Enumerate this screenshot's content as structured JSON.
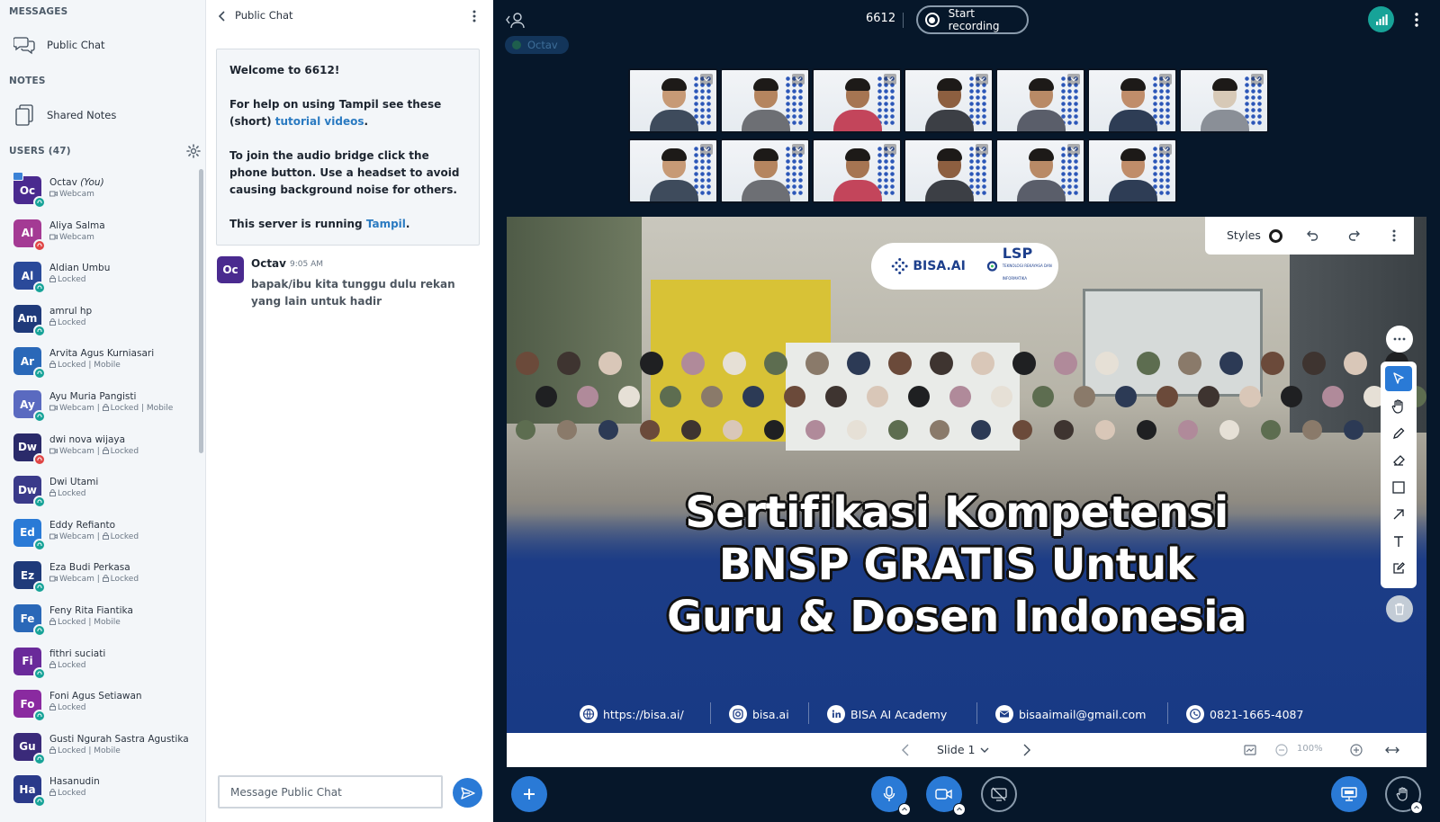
{
  "sidebar": {
    "messages_title": "MESSAGES",
    "public_chat_label": "Public Chat",
    "notes_title": "NOTES",
    "shared_notes_label": "Shared Notes",
    "users_title": "USERS (47)",
    "users": [
      {
        "initials": "Oc",
        "name": "Octav",
        "you": "(You)",
        "status": "Webcam",
        "color": "#4a2a8f",
        "badge": "#17a398",
        "presenter": true
      },
      {
        "initials": "Al",
        "name": "Aliya Salma",
        "status": "Webcam",
        "color": "#a43a94",
        "badge": "#e04545"
      },
      {
        "initials": "Al",
        "name": "Aldian Umbu",
        "status": "Locked",
        "color": "#2a4a9a",
        "badge": "#17a398"
      },
      {
        "initials": "Am",
        "name": "amrul hp",
        "status": "Locked",
        "color": "#1f3a7a",
        "badge": "#17a398"
      },
      {
        "initials": "Ar",
        "name": "Arvita Agus Kurniasari",
        "status": "Locked | Mobile",
        "color": "#2a68b8",
        "badge": "#17a398"
      },
      {
        "initials": "Ay",
        "name": "Ayu Muria Pangisti",
        "status": "Webcam | Locked | Mobile",
        "color": "#5a6ac0",
        "badge": "#17a398"
      },
      {
        "initials": "Dw",
        "name": "dwi nova wijaya",
        "status": "Webcam | Locked",
        "color": "#2a2a6a",
        "badge": "#e04545"
      },
      {
        "initials": "Dw",
        "name": "Dwi Utami",
        "status": "Locked",
        "color": "#3a3a8a",
        "badge": "#17a398"
      },
      {
        "initials": "Ed",
        "name": "Eddy Refianto",
        "status": "Webcam | Locked",
        "color": "#2a7ad6",
        "badge": "#17a398"
      },
      {
        "initials": "Ez",
        "name": "Eza Budi Perkasa",
        "status": "Webcam | Locked",
        "color": "#1f3a7a",
        "badge": "#17a398"
      },
      {
        "initials": "Fe",
        "name": "Feny Rita Fiantika",
        "status": "Locked | Mobile",
        "color": "#2a68b8",
        "badge": "#17a398"
      },
      {
        "initials": "Fi",
        "name": "fithri suciati",
        "status": "Locked",
        "color": "#6a2a9a",
        "badge": "#17a398"
      },
      {
        "initials": "Fo",
        "name": "Foni Agus Setiawan",
        "status": "Locked",
        "color": "#8a2aa0",
        "badge": "#17a398"
      },
      {
        "initials": "Gu",
        "name": "Gusti Ngurah Sastra Agustika",
        "status": "Locked | Mobile",
        "color": "#3a2a7a",
        "badge": "#17a398"
      },
      {
        "initials": "Ha",
        "name": "Hasanudin",
        "status": "Locked",
        "color": "#2a3a8a",
        "badge": "#17a398"
      }
    ]
  },
  "chat": {
    "title": "Public Chat",
    "welcome": {
      "line1_prefix": "Welcome to ",
      "room": "6612",
      "line1_suffix": "!",
      "help_prefix": "For help on using Tampil see these (short) ",
      "help_link": "tutorial videos",
      "help_suffix": ".",
      "audio": "To join the audio bridge click the phone button. Use a headset to avoid causing background noise for others.",
      "server_prefix": "This server is running ",
      "server_link": "Tampil",
      "server_suffix": "."
    },
    "message": {
      "initials": "Oc",
      "author": "Octav",
      "time": "9:05 AM",
      "text": "bapak/ibu kita tunggu dulu rekan yang lain untuk hadir"
    },
    "input_placeholder": "Message Public Chat"
  },
  "meeting": {
    "room": "6612",
    "record_label": "Start recording",
    "talker": "Octav"
  },
  "slide": {
    "logo_bisa": "BISA.AI",
    "logo_lsp": "LSP",
    "logo_lsp_sub": "TEKNOLOGI REKAYASA DAN INFORMATIKA",
    "headline_1": "Sertifikasi Kompetensi",
    "headline_2": "BNSP GRATIS Untuk",
    "headline_3": "Guru &  Dosen Indonesia",
    "contacts": {
      "web": "https://bisa.ai/",
      "instagram": "bisa.ai",
      "linkedin": "BISA AI Academy",
      "email": "bisaaimail@gmail.com",
      "phone": "0821-1665-4087"
    }
  },
  "whiteboard": {
    "styles_label": "Styles"
  },
  "slide_nav": {
    "label": "Slide 1",
    "zoom": "100%"
  }
}
